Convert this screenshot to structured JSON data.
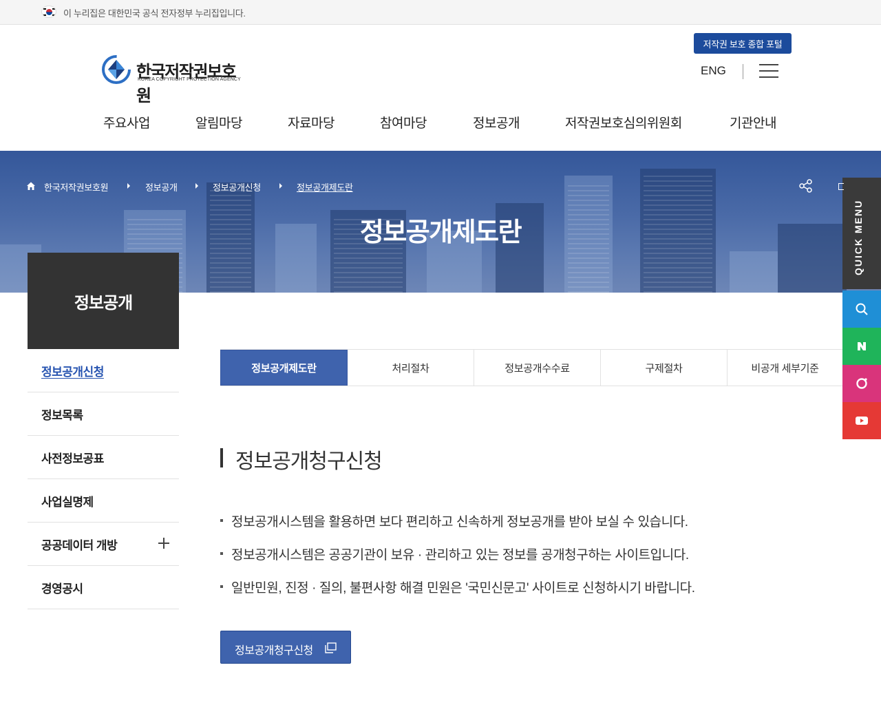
{
  "gov_banner": {
    "text": "이 누리집은 대한민국 공식 전자정부 누리집입니다."
  },
  "header": {
    "logo_ko": "한국저작권보호원",
    "logo_en": "KOREA COPYRIGHT PROTECTION AGENCY",
    "portal_button": "저작권 보호 종합 포털",
    "lang_link": "ENG"
  },
  "gnb": [
    "주요사업",
    "알림마당",
    "자료마당",
    "참여마당",
    "정보공개",
    "저작권보호심의위원회",
    "기관안내"
  ],
  "breadcrumb": [
    "한국저작권보호원",
    "정보공개",
    "정보공개신청",
    "정보공개제도란"
  ],
  "hero": {
    "title": "정보공개제도란"
  },
  "quick_menu": {
    "label": "QUICK MENU",
    "buttons": [
      {
        "icon": "search-icon",
        "color": "#1f8fd6"
      },
      {
        "icon": "naver-icon",
        "color": "#1fb45a"
      },
      {
        "icon": "instagram-icon",
        "color": "#d9347b"
      },
      {
        "icon": "youtube-icon",
        "color": "#e53935"
      }
    ]
  },
  "side_nav": {
    "title": "정보공개",
    "items": [
      {
        "label": "정보공개신청",
        "active": true
      },
      {
        "label": "정보목록"
      },
      {
        "label": "사전정보공표"
      },
      {
        "label": "사업실명제"
      },
      {
        "label": "공공데이터 개방",
        "expandable": true
      },
      {
        "label": "경영공시"
      }
    ]
  },
  "tabs": [
    {
      "label": "정보공개제도란",
      "active": true
    },
    {
      "label": "처리절차"
    },
    {
      "label": "정보공개수수료"
    },
    {
      "label": "구제절차"
    },
    {
      "label": "비공개 세부기준"
    }
  ],
  "content": {
    "section_title": "정보공개청구신청",
    "bullets": [
      "정보공개시스템을 활용하면 보다 편리하고 신속하게 정보공개를 받아 보실 수 있습니다.",
      "정보공개시스템은 공공기관이 보유 · 관리하고 있는 정보를 공개청구하는 사이트입니다.",
      "일반민원, 진정 · 질의, 불편사항 해결 민원은 '국민신문고' 사이트로 신청하시기 바랍니다."
    ],
    "apply_button": "정보공개청구신청"
  },
  "colors": {
    "brand": "#1c4b9c",
    "tab_active": "#3f63ad",
    "side_head": "#333333",
    "active_link": "#2653b0"
  }
}
